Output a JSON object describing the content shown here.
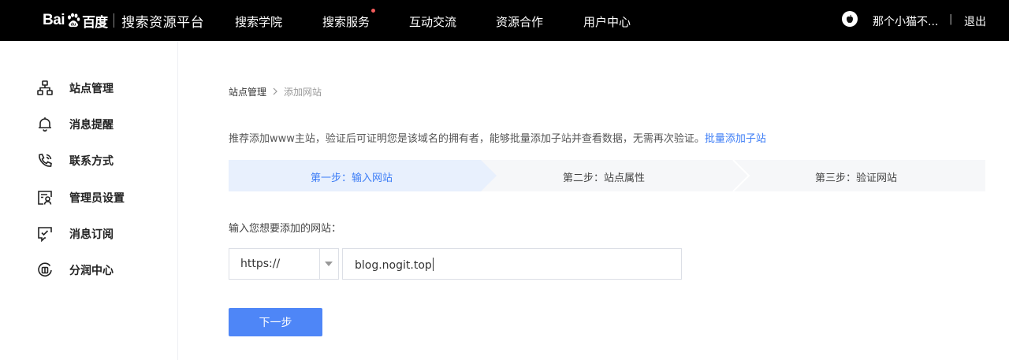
{
  "header": {
    "logo": {
      "word": "Bai",
      "chinese": "百度",
      "product": "搜索资源平台"
    },
    "nav": [
      {
        "label": "搜索学院",
        "badge": false
      },
      {
        "label": "搜索服务",
        "badge": true
      },
      {
        "label": "互动交流",
        "badge": false
      },
      {
        "label": "资源合作",
        "badge": false
      },
      {
        "label": "用户中心",
        "badge": false
      }
    ],
    "user": {
      "name": "那个小猫不...",
      "separator": "|",
      "logout": "退出"
    }
  },
  "sidebar": {
    "items": [
      {
        "label": "站点管理",
        "icon": "sitemap-icon"
      },
      {
        "label": "消息提醒",
        "icon": "bell-icon"
      },
      {
        "label": "联系方式",
        "icon": "phone-icon"
      },
      {
        "label": "管理员设置",
        "icon": "admin-icon"
      },
      {
        "label": "消息订阅",
        "icon": "message-check-icon"
      },
      {
        "label": "分润中心",
        "icon": "revenue-icon"
      }
    ]
  },
  "main": {
    "breadcrumb": {
      "parent": "站点管理",
      "separator": ">",
      "current": "添加网站"
    },
    "tip": {
      "text": "推荐添加www主站，验证后可证明您是该域名的拥有者，能够批量添加子站并查看数据，无需再次验证。",
      "link": "批量添加子站"
    },
    "steps": [
      {
        "label": "第一步：输入网站",
        "active": true
      },
      {
        "label": "第二步：站点属性",
        "active": false
      },
      {
        "label": "第三步：验证网站",
        "active": false
      }
    ],
    "input_label": "输入您想要添加的网站：",
    "protocol": {
      "value": "https://"
    },
    "site": {
      "value": "blog.nogit.top"
    },
    "next_button": "下一步"
  },
  "colors": {
    "topbar": "#000000",
    "accent": "#3b7cf6",
    "button": "#4e86f7",
    "step_active_bg": "#e8f0fd",
    "nav_badge": "#f25b5b"
  }
}
